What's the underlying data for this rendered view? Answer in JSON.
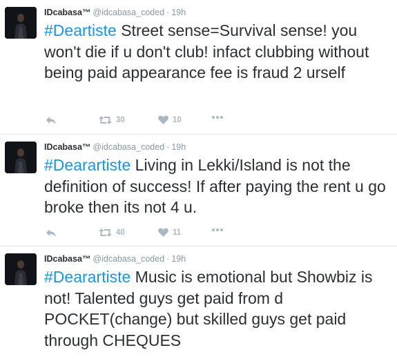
{
  "tweets": [
    {
      "display_name": "IDcabasa™",
      "handle": "@idcabasa_coded",
      "separator": "·",
      "time": "19h",
      "hashtag": "#Deartiste",
      "text": " Street sense=Survival sense! you won't die if u don't club! infact clubbing without being paid appearance fee is fraud 2 urself",
      "retweets": "30",
      "likes": "10",
      "icons": {
        "reply": "reply-icon",
        "retweet": "retweet-icon",
        "like": "heart-icon",
        "more": "more-icon"
      }
    },
    {
      "display_name": "IDcabasa™",
      "handle": "@idcabasa_coded",
      "separator": "·",
      "time": "19h",
      "hashtag": "#Dearartiste",
      "text": " Living in Lekki/Island is not the definition of success! If after paying the rent u go broke then its not 4 u.",
      "retweets": "40",
      "likes": "11",
      "icons": {
        "reply": "reply-icon",
        "retweet": "retweet-icon",
        "like": "heart-icon",
        "more": "more-icon"
      }
    },
    {
      "display_name": "IDcabasa™",
      "handle": "@idcabasa_coded",
      "separator": "·",
      "time": "19h",
      "hashtag": "#Dearartiste",
      "text": " Music is emotional but Showbiz is not! Talented guys get paid from d POCKET(change) but skilled guys get paid through CHEQUES",
      "icons": {
        "reply": "reply-icon",
        "retweet": "retweet-icon",
        "like": "heart-icon",
        "more": "more-icon"
      }
    }
  ],
  "colors": {
    "hashtag": "#1b95e0",
    "text": "#292f33",
    "meta": "#8899a6",
    "icon": "#aab8c2",
    "divider": "#e1e8ed"
  }
}
